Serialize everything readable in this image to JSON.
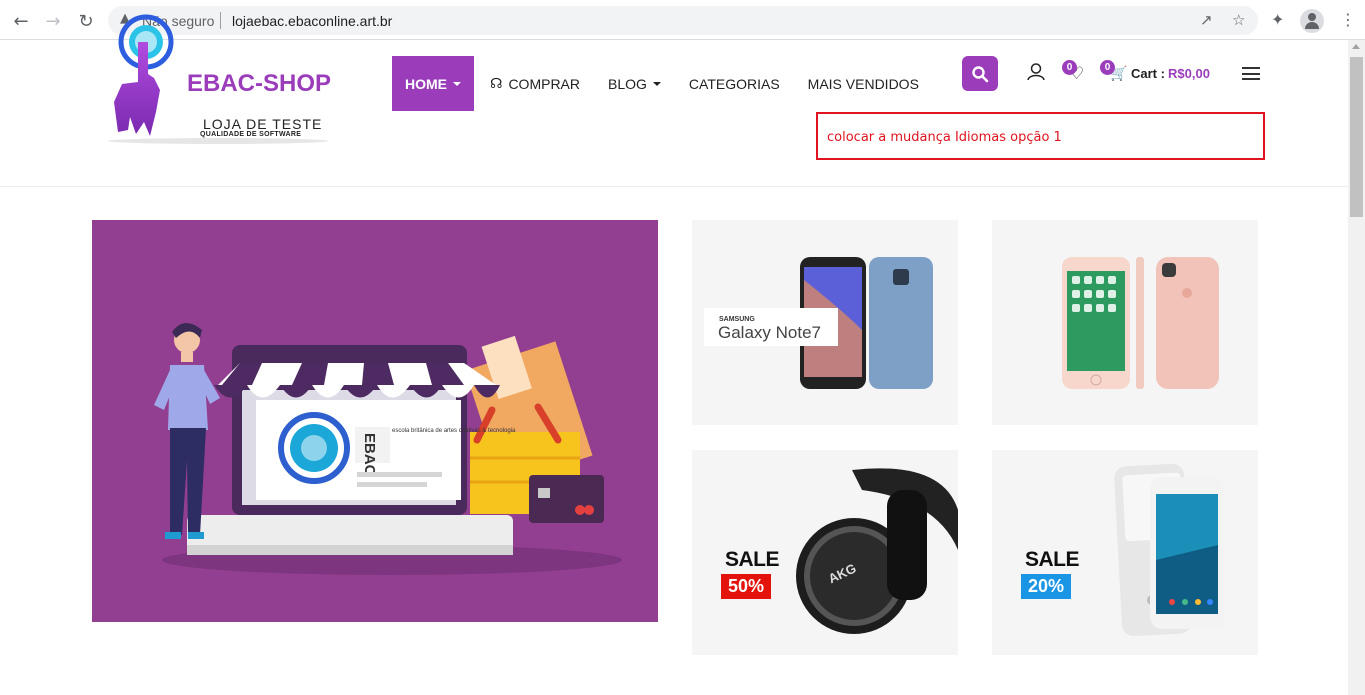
{
  "browser": {
    "security_label": "Não seguro",
    "url": "lojaebac.ebaconline.art.br"
  },
  "site": {
    "brand": "EBAC-SHOP",
    "tagline": "LOJA DE TESTE",
    "tagline_sub": "QUALIDADE DE SOFTWARE",
    "accent_color": "#9b3dbb"
  },
  "menu": [
    {
      "label": "HOME",
      "has_caret": true,
      "active": true
    },
    {
      "label": "COMPRAR",
      "has_icon": "headset-icon"
    },
    {
      "label": "BLOG",
      "has_caret": true
    },
    {
      "label": "CATEGORIAS"
    },
    {
      "label": "MAIS VENDIDOS"
    }
  ],
  "header_icons": {
    "wishlist_count": "0",
    "cart_count": "0",
    "cart_label": "Cart :",
    "cart_total": "R$0,00"
  },
  "notice": {
    "text": "colocar a mudança Idiomas opção 1"
  },
  "hero": {
    "screen_text": "escola britânica de artes criativas & tecnologia",
    "ebac_mark": "EBAC"
  },
  "tiles": [
    {
      "name": "galaxy-note7",
      "brand": "SAMSUNG",
      "product": "Galaxy Note7"
    },
    {
      "name": "iphone7"
    },
    {
      "name": "akg-headphones",
      "sale": "SALE",
      "discount": "50%",
      "discount_color": "#e3120b",
      "product_mark": "AKG"
    },
    {
      "name": "pixel-phone",
      "sale": "SALE",
      "discount": "20%",
      "discount_color": "#1a95e5"
    }
  ]
}
